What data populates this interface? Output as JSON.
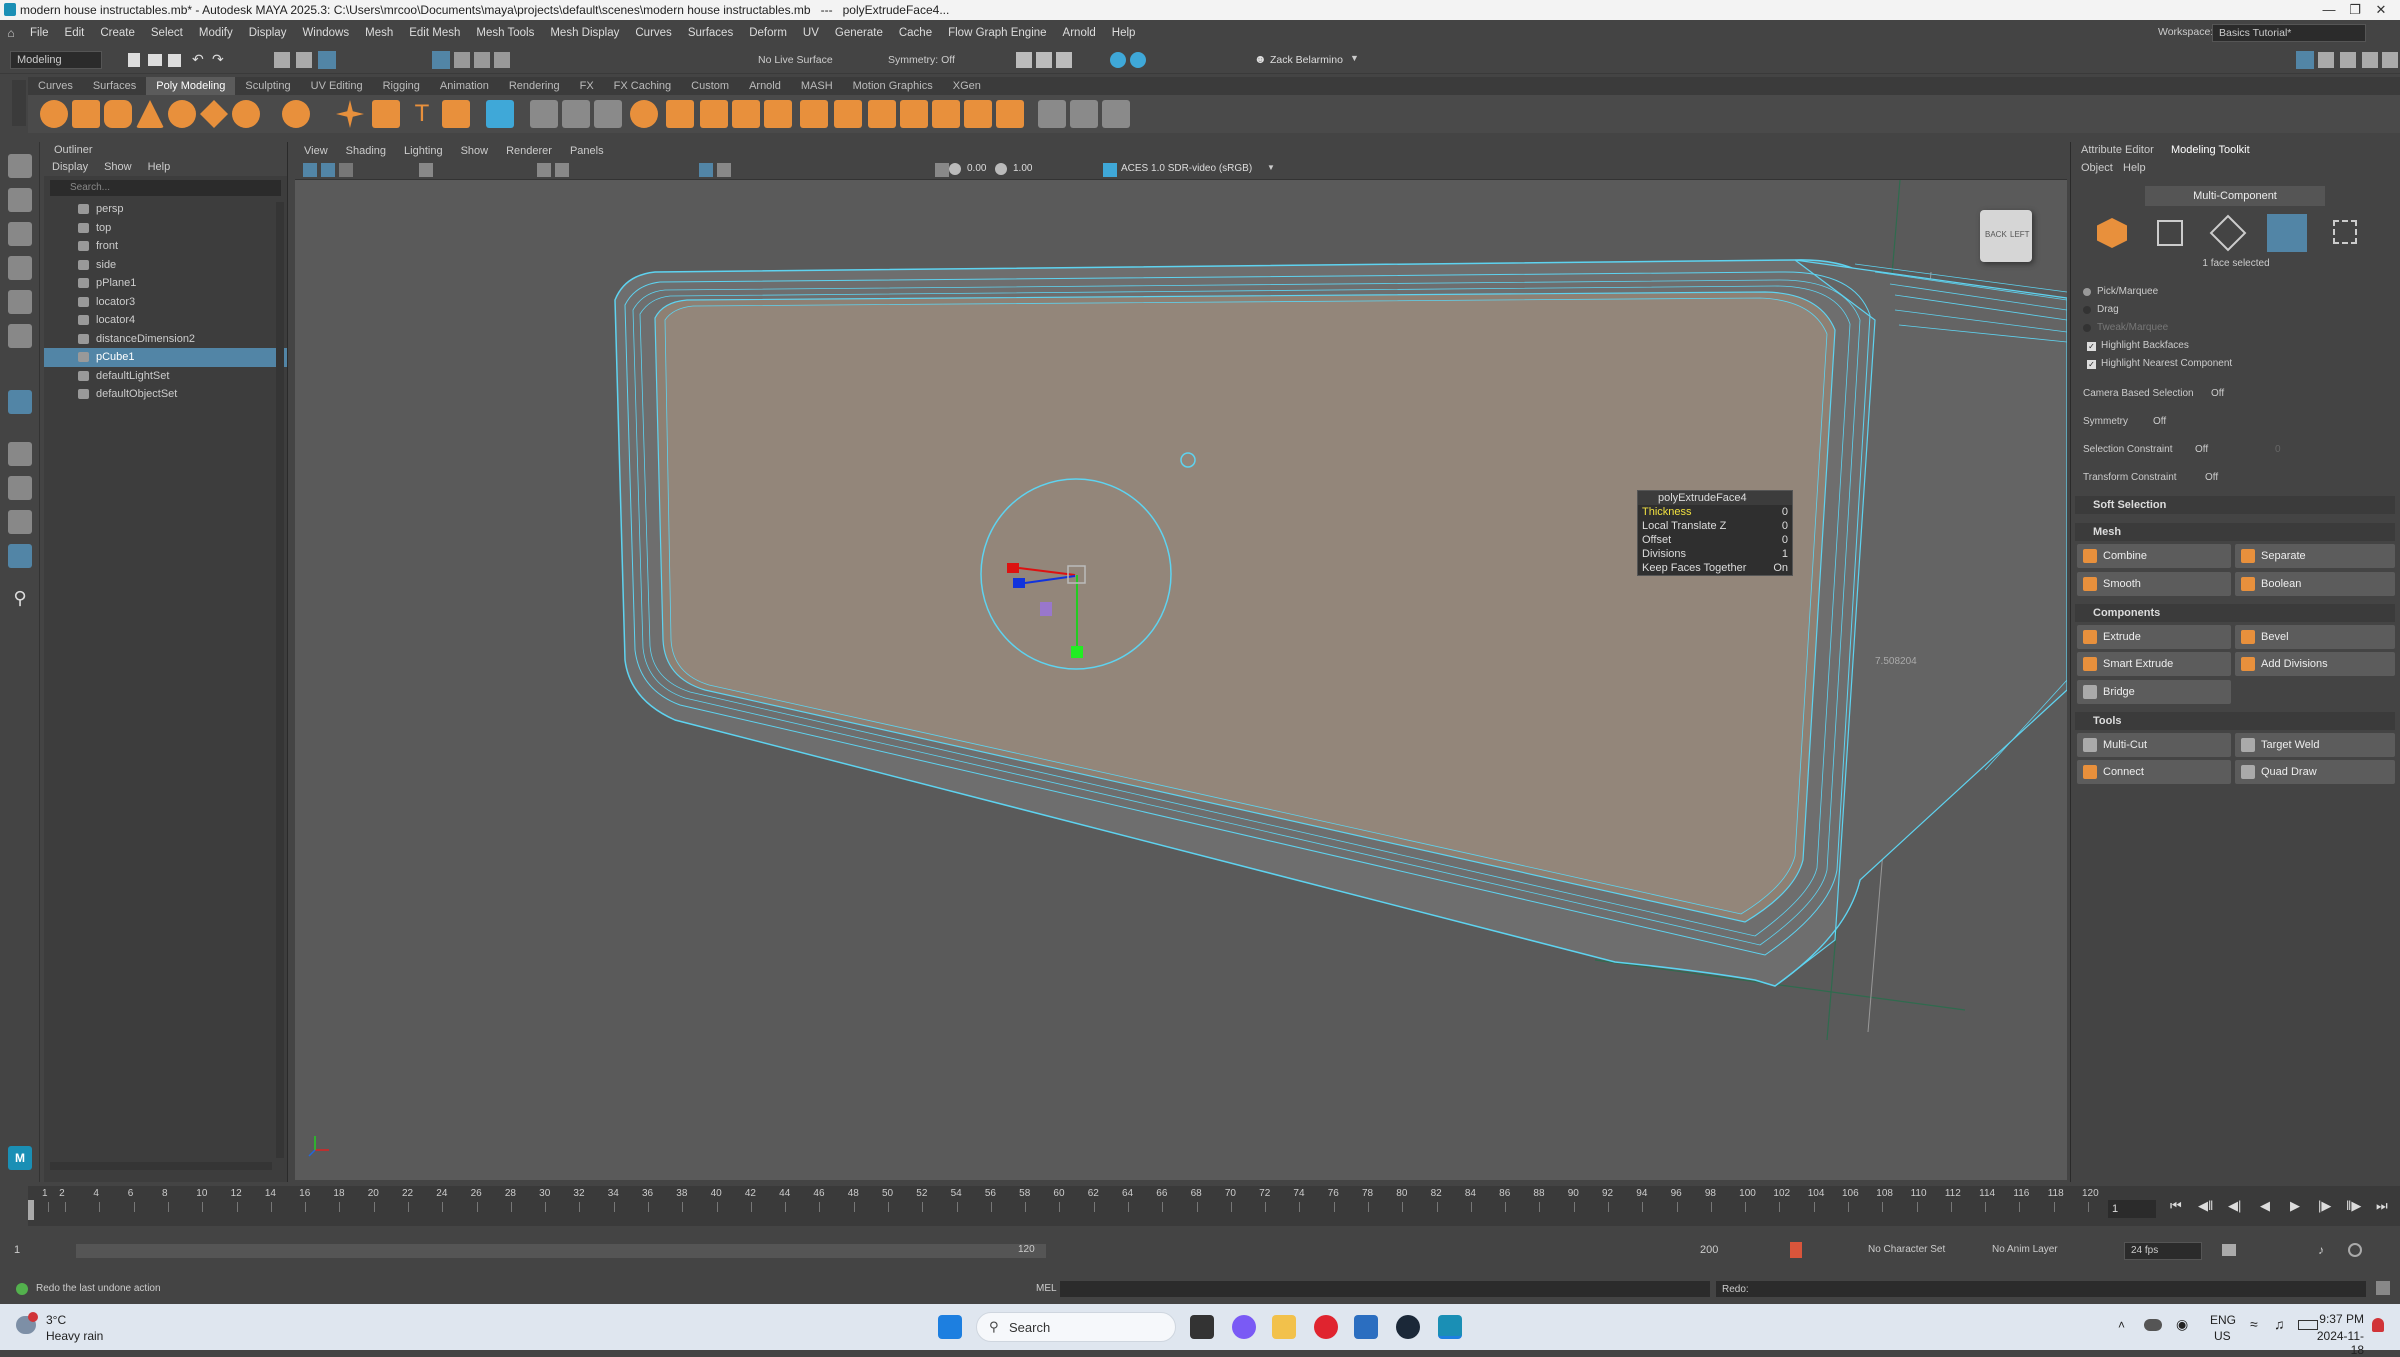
{
  "window": {
    "title": "modern house instructables.mb* - Autodesk MAYA 2025.3: C:\\Users\\mrcoo\\Documents\\maya\\projects\\default\\scenes\\modern house instructables.mb   ---   polyExtrudeFace4..."
  },
  "menubar": [
    "File",
    "Edit",
    "Create",
    "Select",
    "Modify",
    "Display",
    "Windows",
    "Mesh",
    "Edit Mesh",
    "Mesh Tools",
    "Mesh Display",
    "Curves",
    "Surfaces",
    "Deform",
    "UV",
    "Generate",
    "Cache",
    "Flow Graph Engine",
    "Arnold",
    "Help"
  ],
  "workspace": {
    "label": "Workspace:",
    "value": "Basics Tutorial*"
  },
  "statusline": {
    "mode": "Modeling",
    "live_surface": "No Live Surface",
    "symmetry": "Symmetry: Off",
    "user": "Zack Belarmino"
  },
  "shelf_tabs": [
    "Curves",
    "Surfaces",
    "Poly Modeling",
    "Sculpting",
    "UV Editing",
    "Rigging",
    "Animation",
    "Rendering",
    "FX",
    "FX Caching",
    "Custom",
    "Arnold",
    "MASH",
    "Motion Graphics",
    "XGen"
  ],
  "shelf_active": "Poly Modeling",
  "outliner": {
    "title": "Outliner",
    "menu": [
      "Display",
      "Show",
      "Help"
    ],
    "search_placeholder": "Search...",
    "items": [
      {
        "label": "persp",
        "icon": "camera-icon"
      },
      {
        "label": "top",
        "icon": "camera-icon"
      },
      {
        "label": "front",
        "icon": "camera-icon"
      },
      {
        "label": "side",
        "icon": "camera-icon"
      },
      {
        "label": "pPlane1",
        "icon": "mesh-icon"
      },
      {
        "label": "locator3",
        "icon": "locator-icon"
      },
      {
        "label": "locator4",
        "icon": "locator-icon"
      },
      {
        "label": "distanceDimension2",
        "icon": "measure-icon"
      },
      {
        "label": "pCube1",
        "icon": "mesh-icon",
        "selected": true
      },
      {
        "label": "defaultLightSet",
        "icon": "set-icon"
      },
      {
        "label": "defaultObjectSet",
        "icon": "set-icon"
      }
    ]
  },
  "viewport": {
    "menu": [
      "View",
      "Shading",
      "Lighting",
      "Show",
      "Renderer",
      "Panels"
    ],
    "exposure": "0.00",
    "gamma": "1.00",
    "color_space": "ACES 1.0 SDR-video (sRGB)",
    "viewcube": {
      "back": "BACK",
      "left": "LEFT"
    },
    "measure_label": "7.508204",
    "hud": {
      "title": "polyExtrudeFace4",
      "rows": [
        {
          "label": "Thickness",
          "value": "0"
        },
        {
          "label": "Local Translate Z",
          "value": "0"
        },
        {
          "label": "Offset",
          "value": "0"
        },
        {
          "label": "Divisions",
          "value": "1"
        },
        {
          "label": "Keep Faces Together",
          "value": "On"
        }
      ]
    }
  },
  "right_panel": {
    "tabs": [
      "Attribute Editor",
      "Modeling Toolkit"
    ],
    "submenu": [
      "Object",
      "Help"
    ],
    "mode_button": "Multi-Component",
    "selection_info": "1 face selected",
    "pick_options": [
      "Pick/Marquee",
      "Drag",
      "Tweak/Marquee"
    ],
    "checks": [
      "Highlight Backfaces",
      "Highlight Nearest Component"
    ],
    "camera_based": {
      "label": "Camera Based Selection",
      "value": "Off"
    },
    "symmetry": {
      "label": "Symmetry",
      "value": "Off"
    },
    "selection_constraint": {
      "label": "Selection Constraint",
      "value": "Off",
      "extra": "0"
    },
    "transform_constraint": {
      "label": "Transform Constraint",
      "value": "Off"
    },
    "soft_selection": "Soft Selection",
    "mesh_section": "Mesh",
    "mesh_buttons": [
      "Combine",
      "Separate",
      "Smooth",
      "Boolean"
    ],
    "components_section": "Components",
    "components_buttons": [
      "Extrude",
      "Bevel",
      "Smart Extrude",
      "Add Divisions",
      "Bridge"
    ],
    "tools_section": "Tools",
    "tools_buttons": [
      "Multi-Cut",
      "Target Weld",
      "Connect",
      "Quad Draw"
    ]
  },
  "timeline": {
    "ticks": [
      "1",
      "2",
      "4",
      "6",
      "8",
      "10",
      "12",
      "14",
      "16",
      "18",
      "20",
      "22",
      "24",
      "26",
      "28",
      "30",
      "32",
      "34",
      "36",
      "38",
      "40",
      "42",
      "44",
      "46",
      "48",
      "50",
      "52",
      "54",
      "56",
      "58",
      "60",
      "62",
      "64",
      "66",
      "68",
      "70",
      "72",
      "74",
      "76",
      "78",
      "80",
      "82",
      "84",
      "86",
      "88",
      "90",
      "92",
      "94",
      "96",
      "98",
      "100",
      "102",
      "104",
      "106",
      "108",
      "110",
      "112",
      "114",
      "116",
      "118",
      "120"
    ],
    "current_frame": "1"
  },
  "range": {
    "start": "1",
    "inner_start": "1",
    "inner_end": "120",
    "end": "200",
    "character_set": "No Character Set",
    "anim_layer": "No Anim Layer",
    "fps": "24 fps"
  },
  "command": {
    "help_text": "Redo the last undone action",
    "mel": "MEL",
    "output": "Redo:"
  },
  "taskbar": {
    "weather_temp": "3°C",
    "weather_desc": "Heavy rain",
    "search": "Search",
    "lang": "ENG",
    "region": "US",
    "time": "9:37 PM",
    "date": "2024-11-18"
  }
}
